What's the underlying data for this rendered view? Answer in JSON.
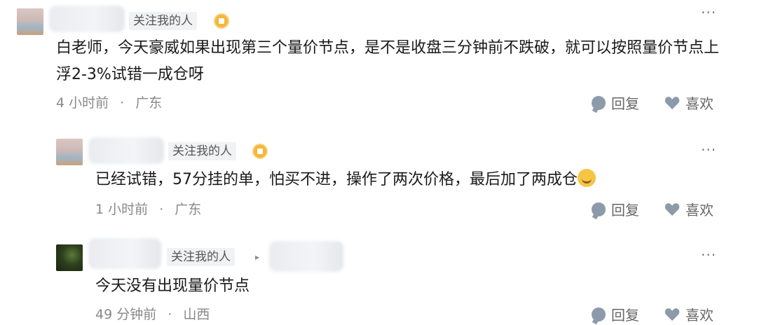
{
  "comments": [
    {
      "follow_label": "关注我的人",
      "text": "白老师，今天豪威如果出现第三个量价节点，是不是收盘三分钟前不跌破，就可以按照量价节点上浮2-3%试错一成仓呀",
      "time": "4 小时前",
      "dot": "·",
      "location": "广东",
      "reply_label": "回复",
      "like_label": "喜欢"
    },
    {
      "follow_label": "关注我的人",
      "text": "已经试错，57分挂的单，怕买不进，操作了两次价格，最后加了两成仓",
      "time": "1 小时前",
      "dot": "·",
      "location": "广东",
      "reply_label": "回复",
      "like_label": "喜欢"
    },
    {
      "follow_label": "关注我的人",
      "text": "今天没有出现量价节点",
      "time": "49 分钟前",
      "dot": "·",
      "location": "山西",
      "reply_label": "回复",
      "like_label": "喜欢"
    }
  ],
  "icons": {
    "more": "more-icon",
    "reply": "reply-icon",
    "like": "heart-icon",
    "badge": "fan-badge-icon",
    "emoji": "laughing-emoji-icon",
    "arrow": "caret-right-icon"
  },
  "colors": {
    "text": "#1a1a1a",
    "meta": "#888888",
    "tag_bg": "#f1f2f4",
    "badge": "#f5b63a",
    "icon": "#8c9aaa"
  }
}
